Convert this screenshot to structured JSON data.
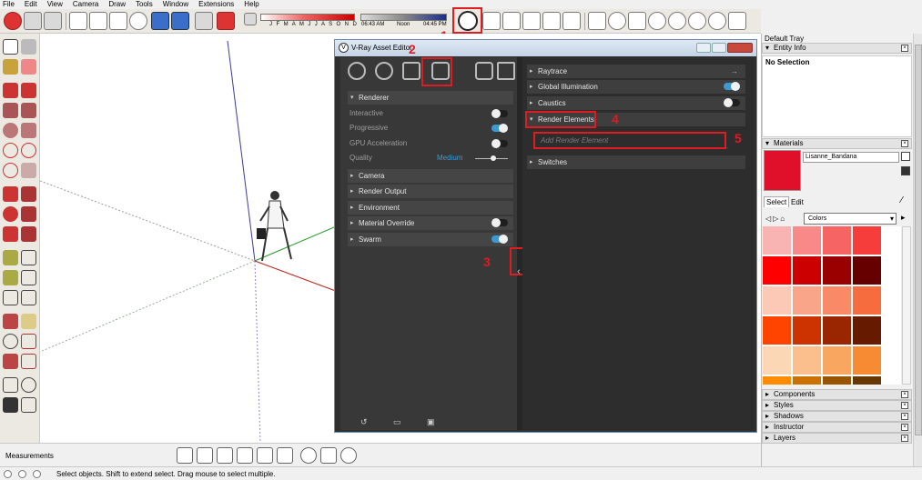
{
  "menu": [
    "File",
    "Edit",
    "View",
    "Camera",
    "Draw",
    "Tools",
    "Window",
    "Extensions",
    "Help"
  ],
  "shadow": {
    "months": "J F M A M J J A S O N D",
    "time_start": "06:43 AM",
    "time_mid": "Noon",
    "time_end": "04:45 PM"
  },
  "annotations": [
    "1",
    "2",
    "3",
    "4",
    "5"
  ],
  "vray": {
    "title": "V-Ray Asset Editor",
    "left_sections": {
      "renderer": "Renderer",
      "interactive": "Interactive",
      "progressive": "Progressive",
      "gpu": "GPU Acceleration",
      "quality": "Quality",
      "quality_value": "Medium",
      "camera": "Camera",
      "render_output": "Render Output",
      "environment": "Environment",
      "material_override": "Material Override",
      "swarm": "Swarm"
    },
    "toggles": {
      "interactive": false,
      "progressive": true,
      "gpu": false,
      "material_override": false,
      "swarm": true,
      "global_illumination": true,
      "caustics": false
    },
    "right_sections": {
      "raytrace": "Raytrace",
      "gi": "Global Illumination",
      "caustics": "Caustics",
      "render_elements": "Render Elements",
      "add_render_element": "Add Render Element",
      "switches": "Switches"
    }
  },
  "tray": {
    "title": "Default Tray",
    "entity_info": "Entity Info",
    "no_selection": "No Selection",
    "materials": "Materials",
    "material_name": "Lisanne_Bandana",
    "tab_select": "Select",
    "tab_edit": "Edit",
    "library": "Colors",
    "components": "Components",
    "styles": "Styles",
    "shadows": "Shadows",
    "instructor": "Instructor",
    "layers": "Layers"
  },
  "swatch_colors": [
    "#f8b3b3",
    "#f88989",
    "#f76464",
    "#f73c3c",
    "#ff0000",
    "#cc0000",
    "#990000",
    "#660000",
    "#fbc9b5",
    "#f9a58a",
    "#f88a68",
    "#f76c3e",
    "#ff4400",
    "#cc3300",
    "#992600",
    "#661a00",
    "#fcd7b5",
    "#fabf8c",
    "#f9a660",
    "#f78b33",
    "#ff8c00",
    "#cc7000",
    "#995400",
    "#663800"
  ],
  "bottom": {
    "measurements": "Measurements",
    "status": "Select objects. Shift to extend select. Drag mouse to select multiple."
  }
}
